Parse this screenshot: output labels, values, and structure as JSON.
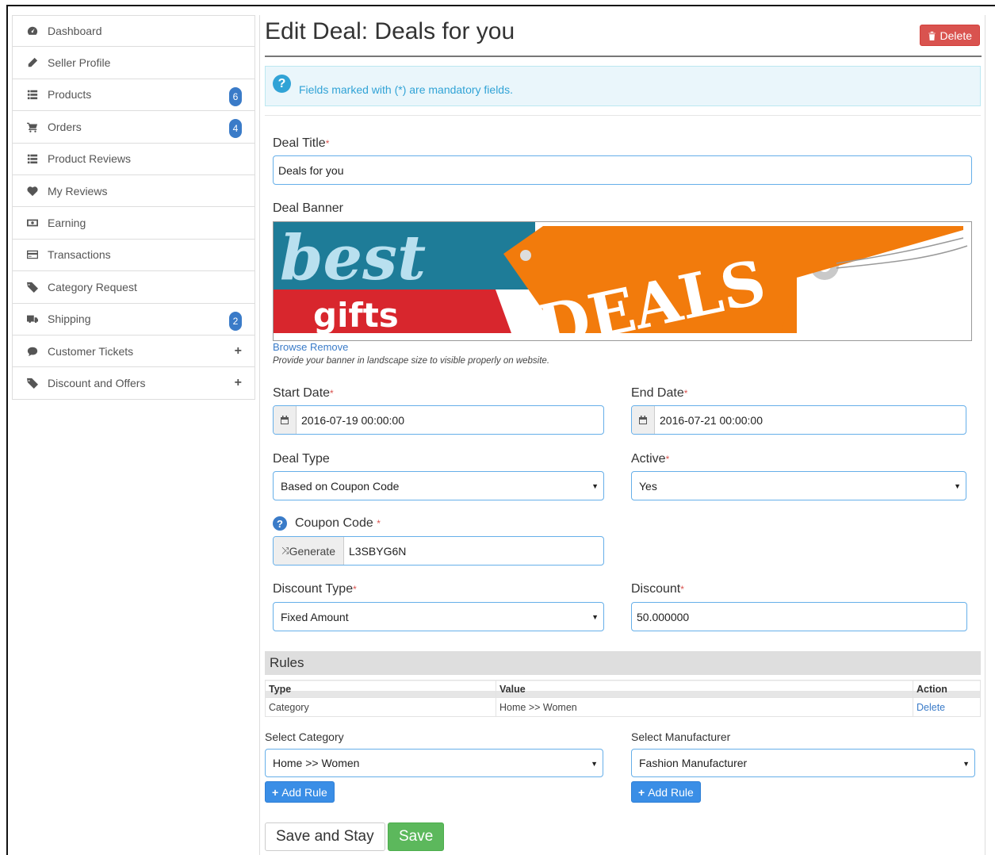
{
  "sidebar": {
    "items": [
      {
        "label": "Dashboard",
        "icon": "dashboard-icon"
      },
      {
        "label": "Seller Profile",
        "icon": "pencil-icon"
      },
      {
        "label": "Products",
        "icon": "list-icon",
        "badge": "6"
      },
      {
        "label": "Orders",
        "icon": "cart-icon",
        "badge": "4"
      },
      {
        "label": "Product Reviews",
        "icon": "list-icon"
      },
      {
        "label": "My Reviews",
        "icon": "heart-icon"
      },
      {
        "label": "Earning",
        "icon": "money-icon"
      },
      {
        "label": "Transactions",
        "icon": "credit-card-icon"
      },
      {
        "label": "Category Request",
        "icon": "tags-icon"
      },
      {
        "label": "Shipping",
        "icon": "truck-icon",
        "badge": "2"
      },
      {
        "label": "Customer Tickets",
        "icon": "comment-icon",
        "expand": "+"
      },
      {
        "label": "Discount and Offers",
        "icon": "tags-icon",
        "expand": "+"
      }
    ]
  },
  "header": {
    "title": "Edit Deal: Deals for you",
    "delete_label": "Delete"
  },
  "info": {
    "text": "Fields marked with (*) are mandatory fields."
  },
  "form": {
    "deal_title_label": "Deal Title",
    "deal_title_value": "Deals for you",
    "banner_label": "Deal Banner",
    "banner_text_top": "best",
    "banner_text_bottom": "gifts",
    "banner_text_right": "DEALS",
    "browse_label": "Browse",
    "remove_label": "Remove",
    "banner_hint": "Provide your banner in landscape size to visible properly on website.",
    "start_date_label": "Start Date",
    "start_date_value": "2016-07-19 00:00:00",
    "end_date_label": "End Date",
    "end_date_value": "2016-07-21 00:00:00",
    "deal_type_label": "Deal Type",
    "deal_type_value": "Based on Coupon Code",
    "active_label": "Active",
    "active_value": "Yes",
    "coupon_label": "Coupon Code",
    "generate_label": "Generate",
    "coupon_value": "L3SBYG6N",
    "discount_type_label": "Discount Type",
    "discount_type_value": "Fixed Amount",
    "discount_label": "Discount",
    "discount_value": "50.000000",
    "required_mark": "*"
  },
  "rules": {
    "heading": "Rules",
    "columns": [
      "Type",
      "Value",
      "Action"
    ],
    "rows": [
      {
        "type": "Category",
        "value": "Home >> Women",
        "action": "Delete"
      }
    ],
    "select_category_label": "Select Category",
    "select_category_value": "Home >> Women",
    "select_manufacturer_label": "Select Manufacturer",
    "select_manufacturer_value": "Fashion Manufacturer",
    "add_rule_label": "Add Rule"
  },
  "actions": {
    "save_stay_label": "Save and Stay",
    "save_label": "Save"
  },
  "colors": {
    "accent": "#3a7bc8",
    "danger": "#d9534f",
    "success": "#5cb85c",
    "info_text": "#31a3d6"
  }
}
